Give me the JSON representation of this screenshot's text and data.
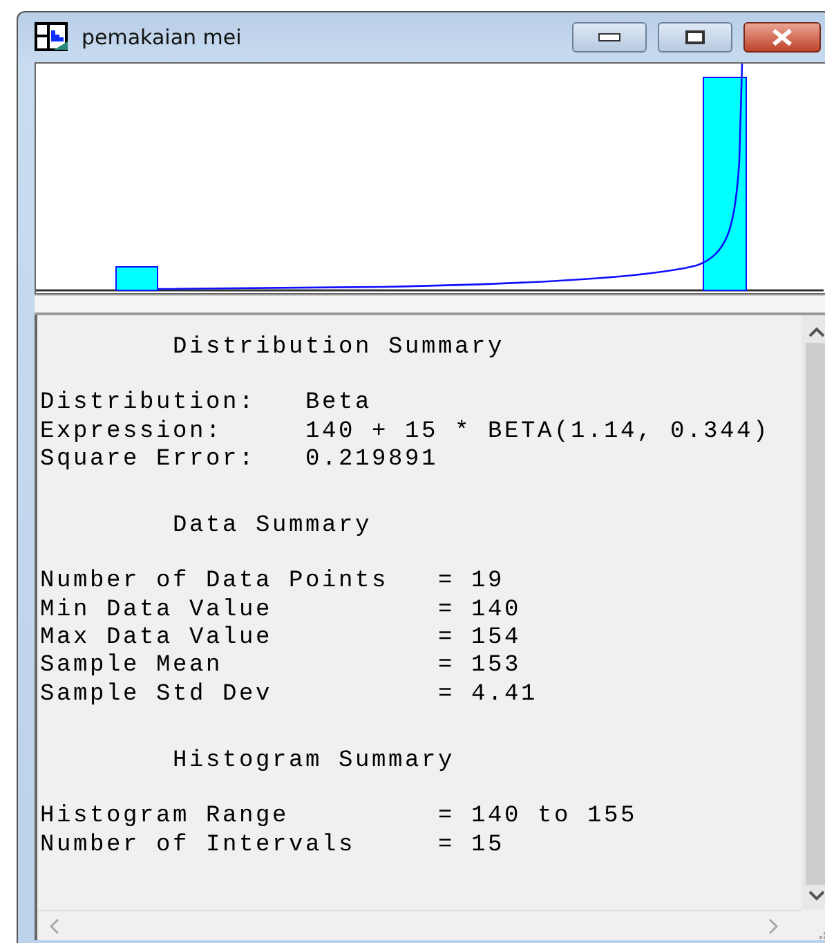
{
  "window": {
    "title": "pemakaian mei"
  },
  "summary": {
    "sections": [
      {
        "kind": "fit",
        "heading": "Distribution Summary",
        "rows": [
          {
            "label": "Distribution:",
            "value": "Beta"
          },
          {
            "label": "Expression:",
            "value": "140 + 15 * BETA(1.14, 0.344)"
          },
          {
            "label": "Square Error:",
            "value": "0.219891"
          }
        ]
      },
      {
        "kind": "stats",
        "heading": "Data Summary",
        "rows": [
          {
            "label": "Number of Data Points",
            "value": "= 19"
          },
          {
            "label": "Min Data Value",
            "value": "= 140"
          },
          {
            "label": "Max Data Value",
            "value": "= 154"
          },
          {
            "label": "Sample Mean",
            "value": "= 153"
          },
          {
            "label": "Sample Std Dev",
            "value": "= 4.41"
          }
        ]
      },
      {
        "kind": "stats",
        "heading": "Histogram Summary",
        "rows": [
          {
            "label": "Histogram Range",
            "value": "= 140 to 155"
          },
          {
            "label": "Number of Intervals",
            "value": "= 15"
          }
        ]
      }
    ]
  }
}
